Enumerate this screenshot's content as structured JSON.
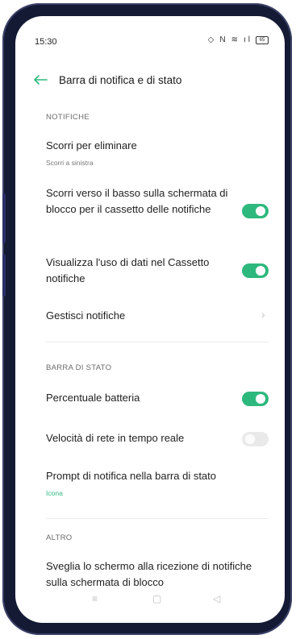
{
  "status": {
    "time": "15:30",
    "icons": [
      "alarm-icon",
      "nfc-icon",
      "wifi-icon",
      "signal-icon"
    ],
    "battery": "65"
  },
  "header": {
    "title": "Barra di notifica e di stato"
  },
  "sections": {
    "notifiche": "NOTIFICHE",
    "barra_di_stato": "BARRA DI STATO",
    "altro": "ALTRO"
  },
  "items": {
    "scorri_eliminare": {
      "title": "Scorri per eliminare",
      "subtitle": "Scorri a sinistra"
    },
    "scorri_basso": {
      "title": "Scorri verso il basso sulla schermata di blocco per il cassetto delle notifiche",
      "enabled": true
    },
    "uso_dati": {
      "title": "Visualizza l'uso di dati nel Cassetto notifiche",
      "enabled": true
    },
    "gestisci": {
      "title": "Gestisci notifiche"
    },
    "percentuale": {
      "title": "Percentuale batteria",
      "enabled": true
    },
    "velocita": {
      "title": "Velocità di rete in tempo reale",
      "enabled": false
    },
    "prompt": {
      "title": "Prompt di notifica nella barra di stato",
      "subtitle": "Icona"
    },
    "sveglia": {
      "title": "Sveglia lo schermo alla ricezione di notifiche sulla schermata di blocco"
    }
  },
  "colors": {
    "accent": "#2db87d",
    "toggle_off": "#e9e9e9",
    "frame": "#141a33"
  },
  "nav": [
    "menu-icon",
    "home-icon",
    "back-triangle-icon"
  ]
}
